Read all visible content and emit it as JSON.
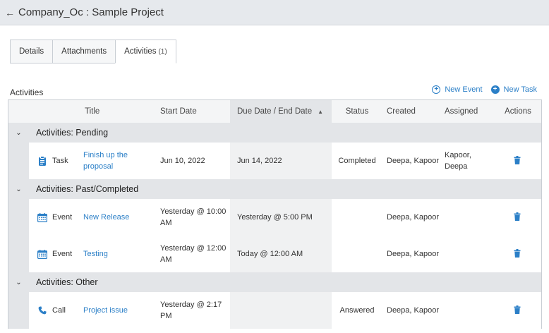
{
  "header": {
    "back_icon": "arrow-left-icon",
    "title": "Company_Oc : Sample Project"
  },
  "tabs": [
    {
      "label": "Details",
      "count": ""
    },
    {
      "label": "Attachments",
      "count": ""
    },
    {
      "label": "Activities",
      "count": "(1)",
      "active": true
    }
  ],
  "section": {
    "title": "Activities"
  },
  "actions": {
    "new_event": "New Event",
    "new_task": "New Task"
  },
  "columns": {
    "title": "Title",
    "start": "Start Date",
    "due": "Due Date / End Date",
    "status": "Status",
    "created": "Created",
    "assigned": "Assigned",
    "actions": "Actions"
  },
  "groups": [
    {
      "label": "Activities: Pending",
      "rows": [
        {
          "type": "Task",
          "icon": "clipboard-icon",
          "title": "Finish up the proposal",
          "start": "Jun 10, 2022",
          "due": "Jun 14, 2022",
          "status": "Completed",
          "created": "Deepa, Kapoor",
          "assigned": "Kapoor, Deepa"
        }
      ]
    },
    {
      "label": "Activities: Past/Completed",
      "rows": [
        {
          "type": "Event",
          "icon": "calendar-icon",
          "title": "New Release",
          "start": "Yesterday @ 10:00 AM",
          "due": "Yesterday @ 5:00 PM",
          "status": "",
          "created": "Deepa, Kapoor",
          "assigned": ""
        },
        {
          "type": "Event",
          "icon": "calendar-icon",
          "title": "Testing",
          "start": "Yesterday @ 12:00 AM",
          "due": "Today @ 12:00 AM",
          "status": "",
          "created": "Deepa, Kapoor",
          "assigned": ""
        }
      ]
    },
    {
      "label": "Activities: Other",
      "rows": [
        {
          "type": "Call",
          "icon": "phone-icon",
          "title": "Project issue",
          "start": "Yesterday @ 2:17 PM",
          "due": "",
          "status": "Answered",
          "created": "Deepa, Kapoor",
          "assigned": ""
        }
      ]
    }
  ],
  "colors": {
    "accent": "#2b7fc7",
    "header_bg": "#e6e9ed",
    "group_bg": "#e3e5e8"
  }
}
